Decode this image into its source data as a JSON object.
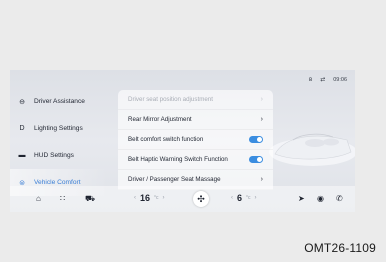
{
  "status": {
    "bluetooth_icon": "bluetooth-icon",
    "signal_icon": "signal-icon",
    "time": "09:06"
  },
  "sidebar": {
    "items": [
      {
        "label": "Driver Assistance",
        "icon": "steering-wheel-icon"
      },
      {
        "label": "Lighting Settings",
        "icon": "headlight-icon"
      },
      {
        "label": "HUD Settings",
        "icon": "hud-icon"
      },
      {
        "label": "Vehicle Comfort",
        "icon": "seat-icon",
        "active": true
      }
    ]
  },
  "menu": {
    "items": [
      {
        "label": "Driver seat position adjustment",
        "control": "chevron",
        "disabled": true
      },
      {
        "label": "Rear Mirror Adjustment",
        "control": "chevron"
      },
      {
        "label": "Belt comfort switch function",
        "control": "toggle",
        "on": true
      },
      {
        "label": "Belt Haptic Warning Switch Function",
        "control": "toggle",
        "on": true
      },
      {
        "label": "Driver / Passenger Seat Massage",
        "control": "chevron"
      }
    ]
  },
  "dock": {
    "left_temp": "16",
    "right_temp": "6",
    "temp_unit": "°c",
    "icons": [
      "home-icon",
      "apps-icon",
      "car-icon",
      "fan-icon",
      "navigation-icon",
      "media-icon",
      "phone-icon"
    ]
  },
  "figure_code": "OMT26-1109",
  "colors": {
    "accent": "#3b7fd6",
    "toggle_on": "#3b8de0"
  }
}
